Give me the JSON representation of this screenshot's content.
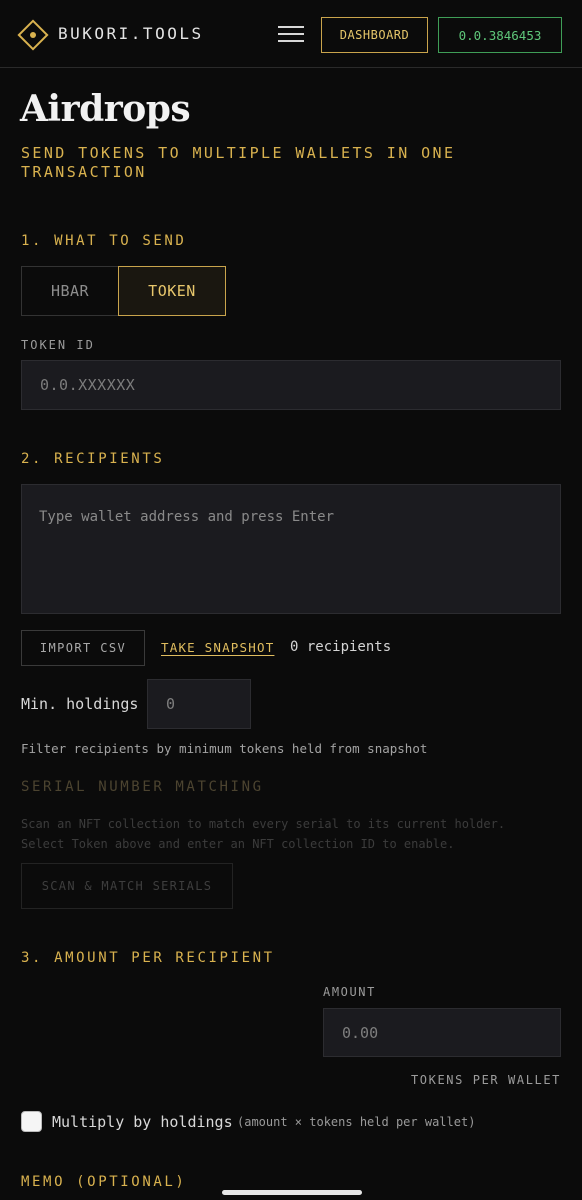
{
  "header": {
    "brand": "BUKORI.TOOLS",
    "dashboard_label": "DASHBOARD",
    "wallet_id": "0.0.3846453"
  },
  "page": {
    "title": "Airdrops",
    "subtitle": "SEND TOKENS TO MULTIPLE WALLETS IN ONE TRANSACTION"
  },
  "what_to_send": {
    "title": "1. WHAT TO SEND",
    "options": [
      "HBAR",
      "TOKEN"
    ],
    "selected": "TOKEN",
    "token_id_label": "TOKEN ID",
    "token_id_placeholder": "0.0.XXXXXX"
  },
  "recipients": {
    "title": "2. RECIPIENTS",
    "placeholder": "Type wallet address and press Enter",
    "import_label": "IMPORT CSV",
    "snapshot_label": "TAKE SNAPSHOT",
    "count_text": "0 recipients",
    "min_holdings_label": "Min. holdings",
    "min_holdings_placeholder": "0",
    "filter_note": "Filter recipients by minimum tokens held from snapshot",
    "serial_title": "SERIAL NUMBER MATCHING",
    "serial_note_1": "Scan an NFT collection to match every serial to its current holder.",
    "serial_note_2": "Select Token above and enter an NFT collection ID to enable.",
    "scan_label": "SCAN & MATCH SERIALS"
  },
  "amount": {
    "title": "3. AMOUNT PER RECIPIENT",
    "label": "AMOUNT",
    "placeholder": "0.00",
    "unit": "TOKENS PER WALLET",
    "multiply_label": "Multiply by holdings",
    "multiply_hint": "(amount × tokens held per wallet)",
    "multiply_checked": false
  },
  "memo": {
    "title": "MEMO (OPTIONAL)"
  },
  "colors": {
    "accent": "#d9b24f",
    "wallet_green": "#5fc77a",
    "background": "#0b0b0b",
    "input_bg": "#1b1b1f"
  }
}
